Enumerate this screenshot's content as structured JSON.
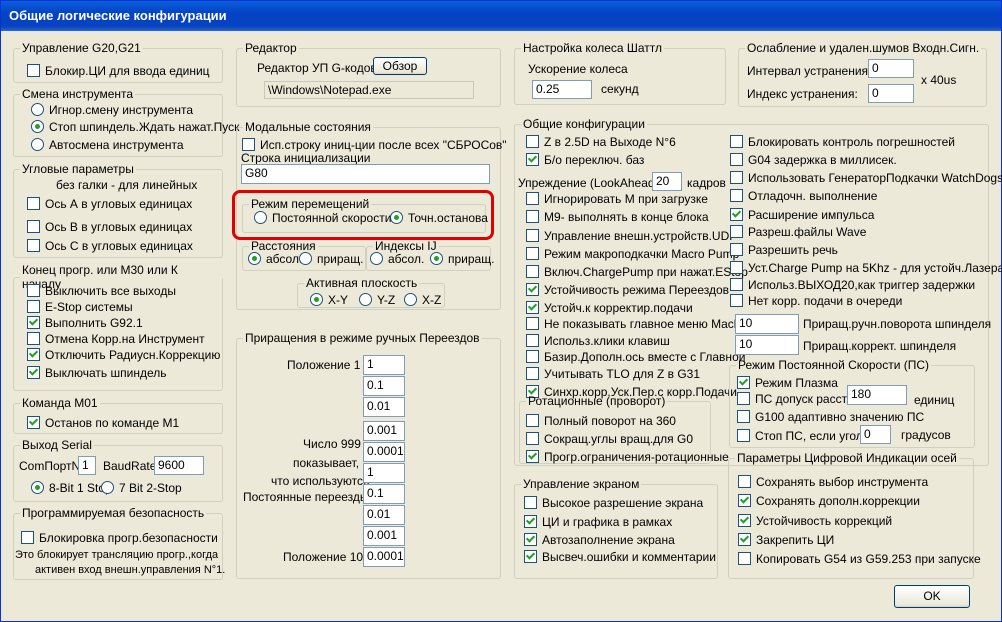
{
  "window": {
    "title": "Общие логические конфигурации"
  },
  "g20": {
    "legend": "Управление G20,G21",
    "block_label": "Блокир.ЦИ для ввода единиц",
    "block_checked": false
  },
  "toolchange": {
    "legend": "Смена инструмента",
    "options": [
      "Игнор.смену инструмента",
      "Стоп шпиндель.Ждать нажат.Пуск",
      "Автосмена инструмента"
    ],
    "selected": 1
  },
  "angular": {
    "legend": "Угловые параметры",
    "hint": "без галки - для линейных",
    "axes": [
      {
        "label": "Ось А в угловых единицах",
        "checked": false
      },
      {
        "label": "Ось B в угловых единицах",
        "checked": false
      },
      {
        "label": "Ось C в угловых единицах",
        "checked": false
      }
    ]
  },
  "m30": {
    "legend": "Конец прогр. или M30 или К началу",
    "items": [
      {
        "label": "Выключить все выходы",
        "checked": false
      },
      {
        "label": "E-Stop системы",
        "checked": false
      },
      {
        "label": "Выполнить G92.1",
        "checked": true
      },
      {
        "label": "Отмена Корр.на Инструмент",
        "checked": false
      },
      {
        "label": "Отключить Радиусн.Коррекцию",
        "checked": true
      },
      {
        "label": "Выключать шпиндель",
        "checked": true
      }
    ]
  },
  "m01": {
    "legend": "Команда M01",
    "label": "Останов по команде M1",
    "checked": true
  },
  "serial": {
    "legend": "Выход Serial",
    "port_label": "ComПортN°",
    "port_value": "1",
    "baud_label": "BaudRate",
    "baud_value": "9600",
    "options": [
      "8-Bit 1 Stop",
      "7 Bit 2-Stop"
    ],
    "selected": 0
  },
  "safety": {
    "legend": "Программируемая безопасность",
    "label": "Блокировка прогр.безопасности",
    "checked": false,
    "note1": "Это блокирует трансляцию прогр.,когда",
    "note2": "активен вход внешн.управления N°1."
  },
  "editor": {
    "legend": "Редактор",
    "label": "Редактор УП G-кодов",
    "browse": "Обзор",
    "path": "\\Windows\\Notepad.exe"
  },
  "modal": {
    "legend": "Модальные состояния",
    "use_init_label": "Исп.строку иниц-ции после всех \"СБРОСов\"",
    "use_init_checked": false,
    "init_label": "Строка инициализации",
    "init_value": "G80"
  },
  "motion": {
    "legend": "Режим перемещений",
    "options": [
      "Постоянной скорости",
      "Точн.останова"
    ],
    "selected": 1
  },
  "distance": {
    "legend": "Расстояния",
    "options": [
      "абсол.",
      "приращ."
    ],
    "selected": 0
  },
  "ij": {
    "legend": "Индексы IJ",
    "options": [
      "абсол.",
      "приращ."
    ],
    "selected": 1
  },
  "plane": {
    "legend": "Активная плоскость",
    "options": [
      "X-Y",
      "Y-Z",
      "X-Z"
    ],
    "selected": 0
  },
  "jog": {
    "legend": "Приращения в режиме ручных Переездов",
    "pos1": "Положение 1",
    "pos10": "Положение 10",
    "note": [
      "Число 999",
      "показывает,",
      "что используются",
      "Постоянные переезды"
    ],
    "values": [
      "1",
      "0.1",
      "0.01",
      "0.001",
      "0.0001",
      "1",
      "0.1",
      "0.01",
      "0.001",
      "0.0001"
    ]
  },
  "mpg": {
    "legend": "Настройка колеса Шаттл",
    "accel_label": "Ускорение колеса",
    "accel_value": "0.25",
    "unit": "секунд"
  },
  "noise": {
    "legend": "Ослабление и удален.шумов Входн.Сигн.",
    "interval_label": "Интервал устранения:",
    "interval_value": "0",
    "factor": "x 40us",
    "index_label": "Индекс устранения:",
    "index_value": "0"
  },
  "general": {
    "legend": "Общие конфигурации",
    "left": [
      {
        "label": "Z в 2.5D на Выходе N°6",
        "checked": false
      },
      {
        "label": "Б/о переключ. баз",
        "checked": true
      }
    ],
    "lookahead_label": "Упреждение (LookAhead)",
    "lookahead_value": "20",
    "lookahead_unit": "кадров",
    "left2": [
      {
        "label": "Игнорировать M при загрузке",
        "checked": false
      },
      {
        "label": "M9- выполнять в конце блока",
        "checked": false
      },
      {
        "label": "Управление внешн.устройств.UDP",
        "checked": false
      },
      {
        "label": "Режим макроподкачки Macro Pump",
        "checked": false
      },
      {
        "label": "Включ.ChargePump при нажат.EStop",
        "checked": false
      },
      {
        "label": "Устойчивость режима Переездов",
        "checked": true
      },
      {
        "label": "Устойч.к корректир.подачи",
        "checked": true
      },
      {
        "label": "Не показывать главное меню Mach3",
        "checked": false
      },
      {
        "label": "Использ.клики клавиш",
        "checked": false
      },
      {
        "label": "Базир.Дополн.ось вместе с Главной",
        "checked": false
      },
      {
        "label": "Учитывать TLO для Z в G31",
        "checked": false
      },
      {
        "label": "Синхр.корр.Уск.Пер.с корр.Подачи",
        "checked": true
      }
    ],
    "right": [
      {
        "label": "Блокировать контроль погрешностей",
        "checked": false
      },
      {
        "label": "G04 задержка в миллисек.",
        "checked": false
      },
      {
        "label": "Использовать ГенераторПодкачки WatchDogs",
        "checked": false
      },
      {
        "label": "Отладочн. выполнение",
        "checked": false
      },
      {
        "label": "Расширение импульса",
        "checked": true
      },
      {
        "label": "Разреш.файлы Wave",
        "checked": false
      },
      {
        "label": "Разрешить речь",
        "checked": false
      },
      {
        "label": "Уст.Charge Pump на 5Khz - для устойч.Лазера",
        "checked": false
      },
      {
        "label": "Использ.ВЫХОД20,как триггер задержки",
        "checked": false
      },
      {
        "label": "Нет корр. подачи в очереди",
        "checked": false
      }
    ],
    "spindle_rot_value": "10",
    "spindle_rot_label": "Приращ.ручн.поворота шпинделя",
    "spindle_corr_value": "10",
    "spindle_corr_label": "Приращ.коррект. шпинделя"
  },
  "rotation": {
    "legend": "Ротационные (проворот)",
    "items": [
      {
        "label": "Полный поворот на 360",
        "checked": false
      },
      {
        "label": "Сокращ.углы вращ.для G0",
        "checked": false
      },
      {
        "label": "Прогр.ограничения-ротационные",
        "checked": true
      }
    ]
  },
  "css": {
    "legend": "Режим Постоянной Скорости (ПС)",
    "plasma_label": "Режим Плазма",
    "plasma_checked": true,
    "tol_label": "ПС допуск расст.",
    "tol_checked": false,
    "tol_value": "180",
    "tol_unit": "единиц",
    "g100_label": "G100 адаптивно значению ПС",
    "g100_checked": false,
    "stop_label": "Стоп ПС, если угол >",
    "stop_checked": false,
    "stop_value": "0",
    "stop_unit": "градусов"
  },
  "screen": {
    "legend": "Управление экраном",
    "items": [
      {
        "label": "Высокое разрешение экрана",
        "checked": false
      },
      {
        "label": "ЦИ и графика в рамках",
        "checked": true
      },
      {
        "label": "Автозаполнение экрана",
        "checked": true
      },
      {
        "label": "Высвеч.ошибки и комментарии",
        "checked": true
      }
    ]
  },
  "dro": {
    "legend": "Параметры Цифровой Индикации осей",
    "items": [
      {
        "label": "Сохранять выбор инструмента",
        "checked": false
      },
      {
        "label": "Сохранять дополн.коррекции",
        "checked": true
      },
      {
        "label": "Устойчивость коррекций",
        "checked": true
      },
      {
        "label": "Закрепить ЦИ",
        "checked": true
      },
      {
        "label": "Копировать G54 из G59.253 при запуске",
        "checked": false
      }
    ]
  },
  "ok": "OK"
}
